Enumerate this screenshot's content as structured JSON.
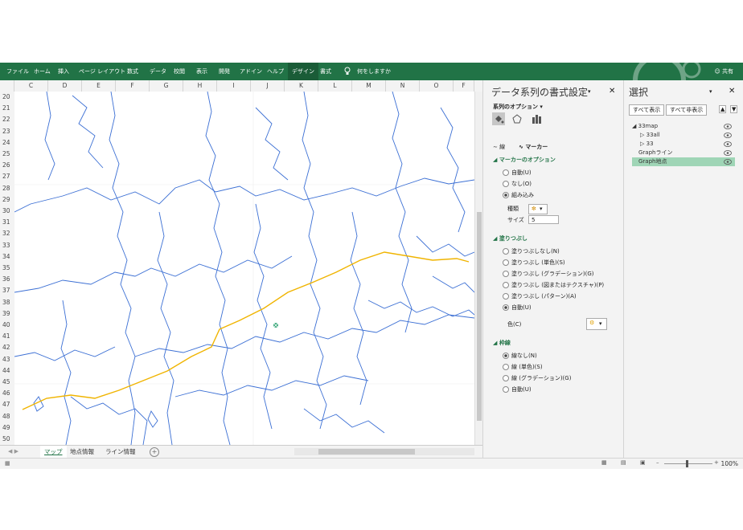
{
  "ribbon": {
    "tabs": [
      "ファイル",
      "ホーム",
      "挿入",
      "ページ レイアウト",
      "数式",
      "データ",
      "校閲",
      "表示",
      "開発",
      "アドイン",
      "ヘルプ",
      "デザイン",
      "書式"
    ],
    "active_tab": "デザイン",
    "tellme": "何をしますか",
    "share": "共有"
  },
  "grid": {
    "columns": [
      "C",
      "D",
      "E",
      "F",
      "G",
      "H",
      "I",
      "J",
      "K",
      "L",
      "M",
      "N",
      "O",
      "F"
    ],
    "rows": [
      "20",
      "21",
      "22",
      "23",
      "24",
      "25",
      "26",
      "27",
      "28",
      "29",
      "30",
      "31",
      "32",
      "33",
      "34",
      "35",
      "36",
      "37",
      "38",
      "39",
      "40",
      "41",
      "42",
      "43",
      "44",
      "45",
      "46",
      "47",
      "48",
      "49",
      "50"
    ]
  },
  "sheet_tabs": [
    "マップ",
    "地点情報",
    "ライン情報"
  ],
  "active_sheet": "マップ",
  "status": {
    "zoom": "100%"
  },
  "format_pane": {
    "title": "データ系列の書式設定",
    "series_options": "系列のオプション",
    "line_tab": "線",
    "marker_tab": "マーカー",
    "marker_options": {
      "heading": "マーカーのオプション",
      "options": [
        "自動(U)",
        "なし(O)",
        "組み込み"
      ],
      "selected": "組み込み",
      "kind_label": "種類",
      "size_label": "サイズ",
      "size_value": "5"
    },
    "fill": {
      "heading": "塗りつぶし",
      "options": [
        "塗りつぶしなし(N)",
        "塗りつぶし (単色)(S)",
        "塗りつぶし (グラデーション)(G)",
        "塗りつぶし (図またはテクスチャ)(P)",
        "塗りつぶし (パターン)(A)",
        "自動(U)"
      ],
      "selected": "自動(U)",
      "color_label": "色(C)"
    },
    "border": {
      "heading": "枠線",
      "options": [
        "線なし(N)",
        "線 (単色)(S)",
        "線 (グラデーション)(G)",
        "自動(U)"
      ],
      "selected": "線なし(N)"
    }
  },
  "selection_pane": {
    "title": "選択",
    "show_all": "すべて表示",
    "hide_all": "すべて非表示",
    "items": [
      {
        "label": "33map",
        "level": 0
      },
      {
        "label": "33all",
        "level": 1
      },
      {
        "label": "33",
        "level": 1
      },
      {
        "label": "Graphライン",
        "level": 0
      },
      {
        "label": "Graph地点",
        "level": 0
      }
    ],
    "selected": "Graph地点"
  },
  "colors": {
    "excel_green": "#217346",
    "map_line": "#3b6fd4",
    "route_line": "#f0b400",
    "marker": "#3aa87a"
  }
}
